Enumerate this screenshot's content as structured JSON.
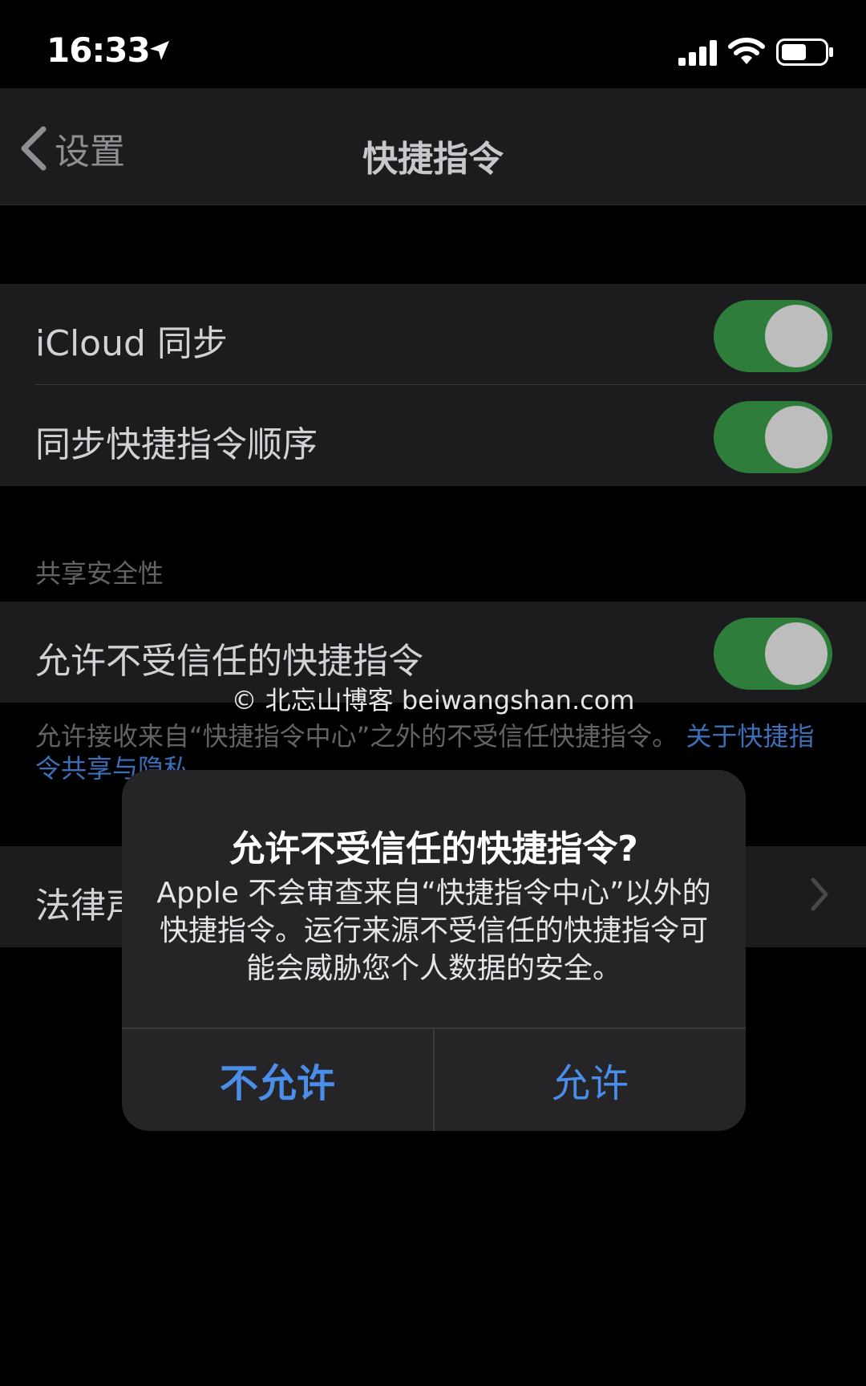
{
  "status_bar": {
    "time": "16:33",
    "icons": [
      "location-arrow-icon",
      "cellular-signal-icon",
      "wifi-icon",
      "battery-icon"
    ]
  },
  "nav": {
    "back_label": "设置",
    "title": "快捷指令"
  },
  "sync_section": {
    "items": [
      {
        "label": "iCloud 同步",
        "enabled": true
      },
      {
        "label": "同步快捷指令顺序",
        "enabled": true
      }
    ]
  },
  "sharing_section": {
    "header": "共享安全性",
    "item": {
      "label": "允许不受信任的快捷指令",
      "enabled": true
    },
    "footer_text": "允许接收来自“快捷指令中心”之外的不受信任快捷指令。",
    "footer_link": "关于快捷指令共享与隐私"
  },
  "legal_section": {
    "label": "法律声明"
  },
  "watermark": "© 北忘山博客 beiwangshan.com",
  "alert": {
    "title": "允许不受信任的快捷指令?",
    "message": "Apple 不会审查来自“快捷指令中心”以外的快捷指令。运行来源不受信任的快捷指令可能会威胁您个人数据的安全。",
    "cancel_label": "不允许",
    "confirm_label": "允许"
  },
  "colors": {
    "background": "#000000",
    "cell_background": "#1c1c1e",
    "toggle_on": "#2f7d3a",
    "link_blue": "#4a8eea",
    "alert_background": "#252527"
  }
}
